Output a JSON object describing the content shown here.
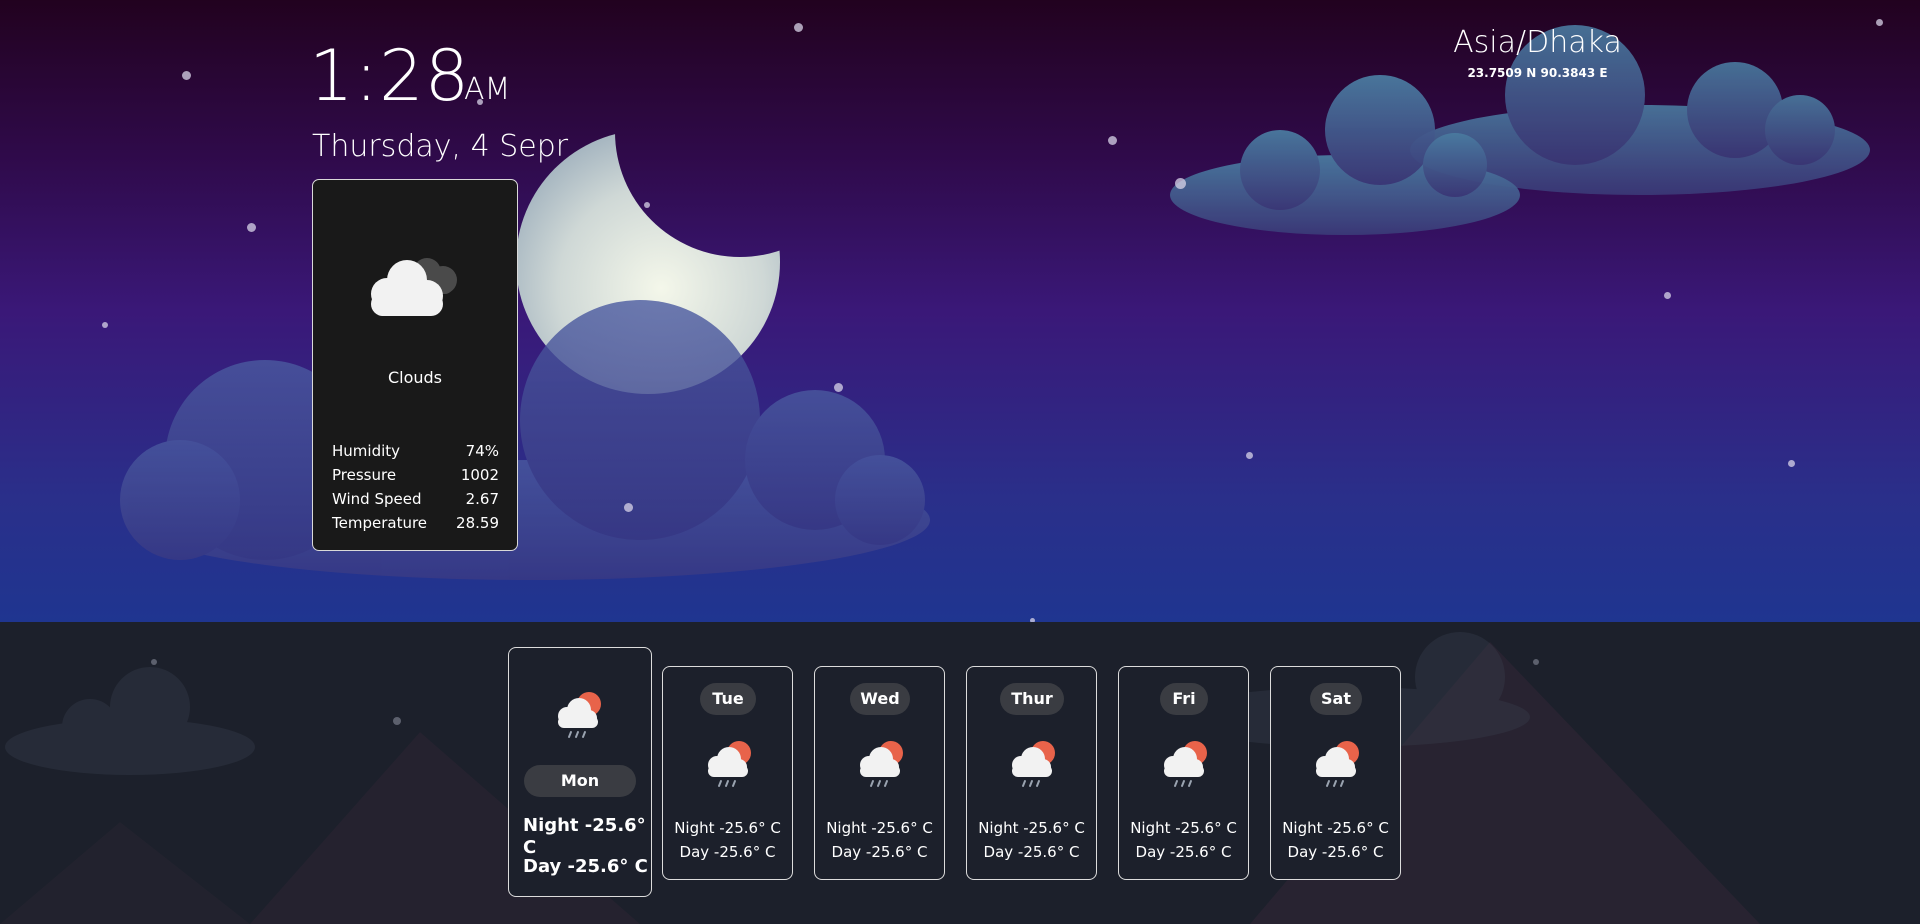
{
  "clock": {
    "time": "1:28",
    "ampm": "AM",
    "date": "Thursday, 4 Sepr"
  },
  "location": {
    "timezone": "Asia/Dhaka",
    "coordinates": "23.7509 N 90.3843 E"
  },
  "current": {
    "icon": "clouds-icon",
    "description": "Clouds",
    "stats": [
      {
        "label": "Humidity",
        "value": "74%"
      },
      {
        "label": "Pressure",
        "value": "1002"
      },
      {
        "label": "Wind Speed",
        "value": "2.67"
      },
      {
        "label": "Temperature",
        "value": "28.59"
      }
    ]
  },
  "forecast": [
    {
      "day": "Mon",
      "night": "Night -25.6° C",
      "dayTemp": "Day -25.6° C",
      "icon": "rain-sun-icon"
    },
    {
      "day": "Tue",
      "night": "Night -25.6° C",
      "dayTemp": "Day -25.6° C",
      "icon": "rain-sun-icon"
    },
    {
      "day": "Wed",
      "night": "Night -25.6° C",
      "dayTemp": "Day -25.6° C",
      "icon": "rain-sun-icon"
    },
    {
      "day": "Thur",
      "night": "Night -25.6° C",
      "dayTemp": "Day -25.6° C",
      "icon": "rain-sun-icon"
    },
    {
      "day": "Fri",
      "night": "Night -25.6° C",
      "dayTemp": "Day -25.6° C",
      "icon": "rain-sun-icon"
    },
    {
      "day": "Sat",
      "night": "Night -25.6° C",
      "dayTemp": "Day -25.6° C",
      "icon": "rain-sun-icon"
    }
  ],
  "colors": {
    "card_background": "#191919",
    "forecast_background": "#1c202b",
    "sun_accent": "#e8634a"
  }
}
